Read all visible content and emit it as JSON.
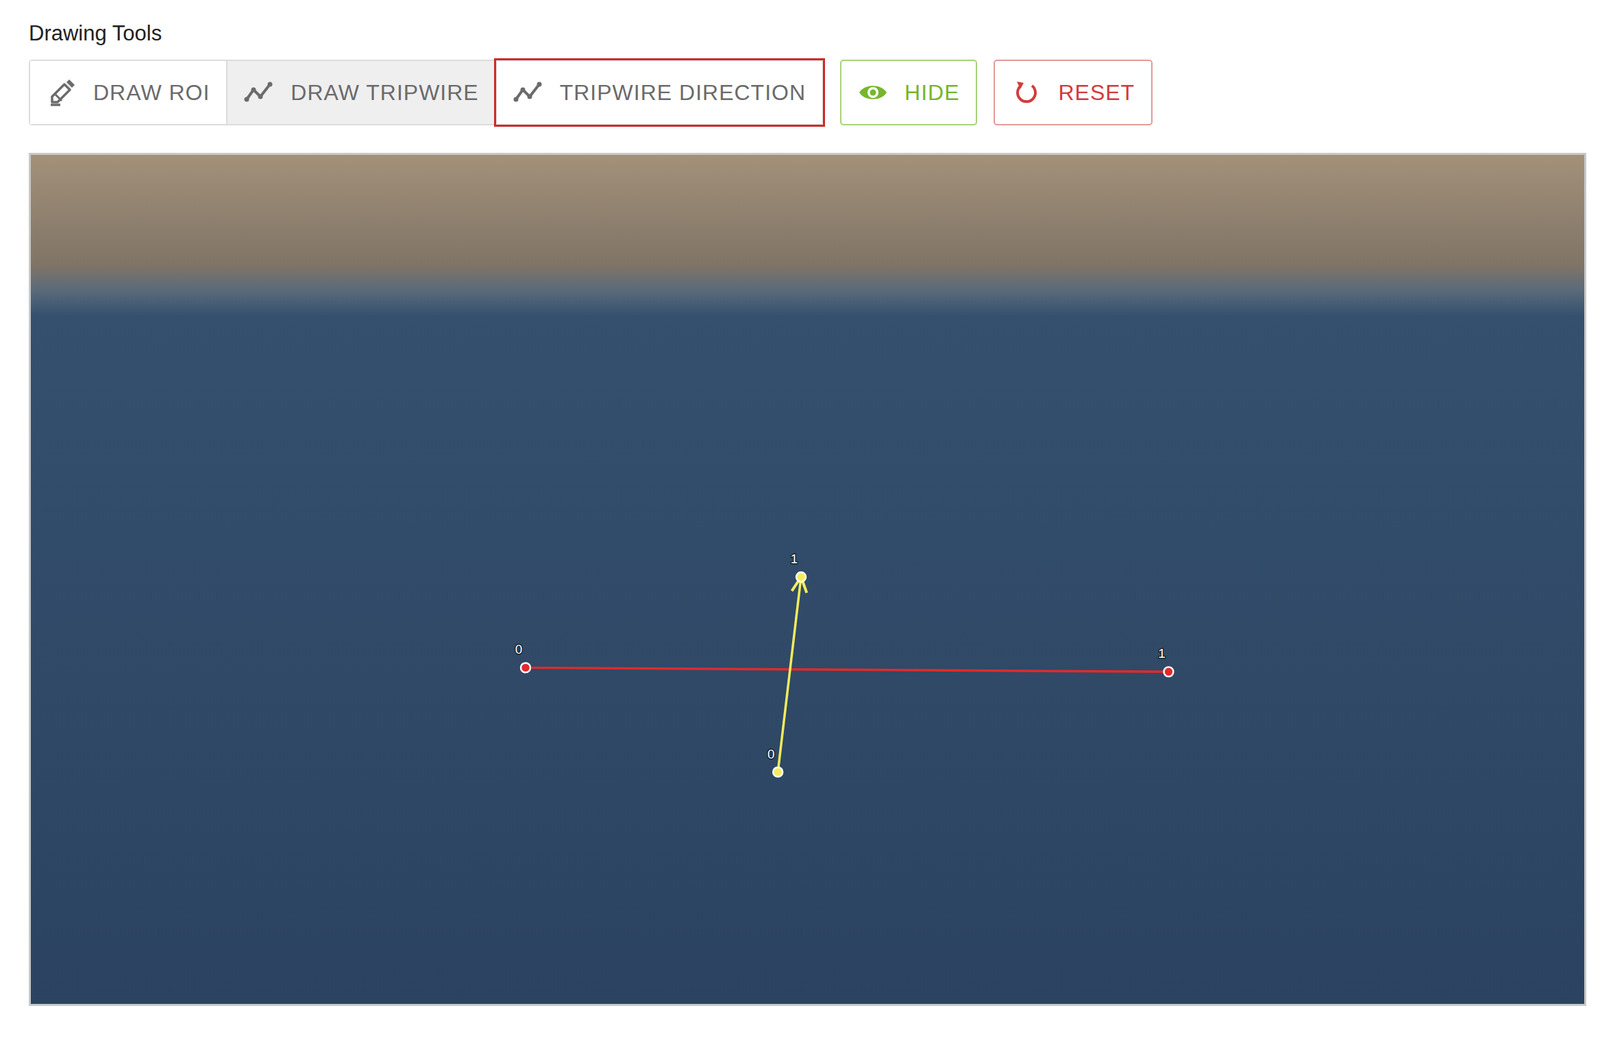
{
  "title": "Drawing Tools",
  "buttons": [
    {
      "label": "DRAW ROI",
      "kind": "tool",
      "selected": false,
      "highlighted": false
    },
    {
      "label": "DRAW TRIPWIRE",
      "kind": "tool",
      "selected": true,
      "highlighted": false
    },
    {
      "label": "TRIPWIRE DIRECTION",
      "kind": "tool",
      "selected": false,
      "highlighted": true
    },
    {
      "label": "HIDE",
      "kind": "success",
      "selected": false,
      "highlighted": false
    },
    {
      "label": "RESET",
      "kind": "danger",
      "selected": false,
      "highlighted": false
    }
  ],
  "video": {
    "overlays": [
      {
        "kind": "line",
        "color": "#e02b2b",
        "points": [
          {
            "label": "0"
          },
          {
            "label": "1"
          }
        ]
      },
      {
        "kind": "arrow",
        "color": "#f4ec5c",
        "points": [
          {
            "label": "0"
          },
          {
            "label": "1"
          }
        ]
      }
    ]
  }
}
